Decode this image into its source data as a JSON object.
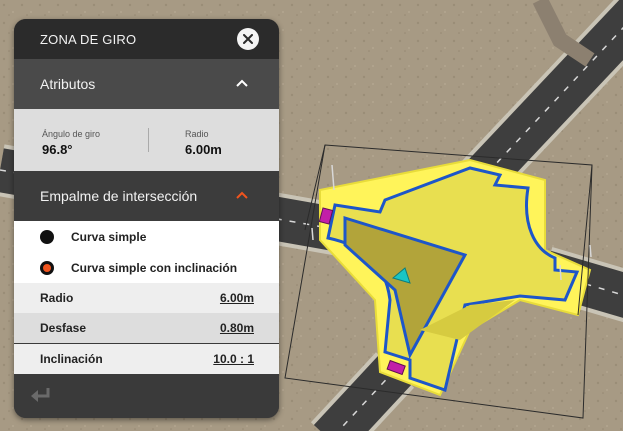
{
  "panel": {
    "title": "ZONA DE GIRO",
    "attributes_header": "Atributos",
    "angle_label": "Ángulo de giro",
    "angle_value": "96.8°",
    "radius_label": "Radio",
    "radius_value": "6.00m",
    "junction_header": "Empalme de intersección",
    "options": [
      {
        "label": "Curva simple",
        "selected": false
      },
      {
        "label": "Curva simple con inclinación",
        "selected": true
      }
    ],
    "params": [
      {
        "label": "Radio",
        "value": "6.00m"
      },
      {
        "label": "Desfase",
        "value": "0.80m"
      },
      {
        "label": "Inclinación",
        "value": "10.0 : 1"
      }
    ]
  },
  "colors": {
    "accent": "#f0541e",
    "panel_dark": "#2b2b2b",
    "highlight_yellow": "#fff45a",
    "outline_blue": "#1d56c9",
    "handle_magenta": "#c21fa8",
    "handle_cyan": "#19c5c5"
  },
  "icons": [
    "close-icon",
    "chevron-up-icon",
    "radio-icon",
    "undo-icon"
  ]
}
